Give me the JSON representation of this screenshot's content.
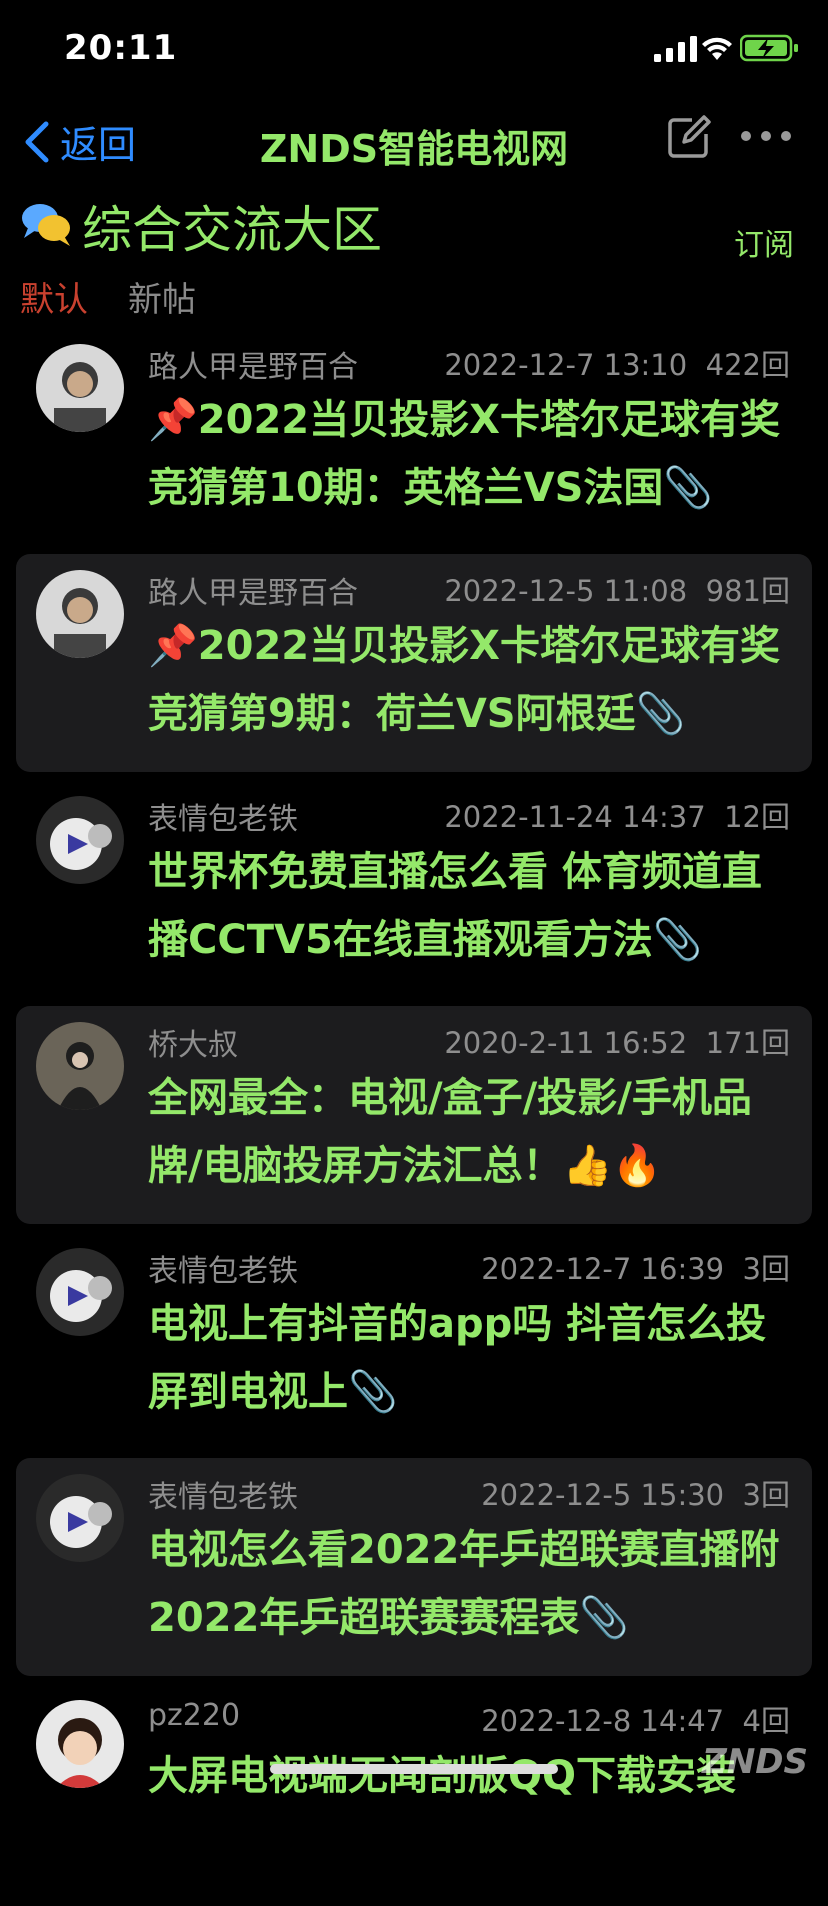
{
  "status_bar": {
    "time": "20:11"
  },
  "nav": {
    "back_label": "返回",
    "title": "ZNDS智能电视网"
  },
  "forum": {
    "name": "综合交流大区",
    "subscribe_label": "订阅",
    "tabs": [
      {
        "label": "默认",
        "active": true
      },
      {
        "label": "新帖",
        "active": false
      }
    ]
  },
  "threads": [
    {
      "author": "路人甲是野百合",
      "date": "2022-12-7 13:10",
      "replies": "422回",
      "title": "📌2022当贝投影X卡塔尔足球有奖竞猜第10期：英格兰VS法国📎"
    },
    {
      "author": "路人甲是野百合",
      "date": "2022-12-5 11:08",
      "replies": "981回",
      "title": "📌2022当贝投影X卡塔尔足球有奖竞猜第9期：荷兰VS阿根廷📎"
    },
    {
      "author": "表情包老铁",
      "date": "2022-11-24 14:37",
      "replies": "12回",
      "title": "世界杯免费直播怎么看 体育频道直播CCTV5在线直播观看方法📎"
    },
    {
      "author": "桥大叔",
      "date": "2020-2-11 16:52",
      "replies": "171回",
      "title": "全网最全：电视/盒子/投影/手机品牌/电脑投屏方法汇总！👍🔥"
    },
    {
      "author": "表情包老铁",
      "date": "2022-12-7 16:39",
      "replies": "3回",
      "title": "电视上有抖音的app吗 抖音怎么投屏到电视上📎"
    },
    {
      "author": "表情包老铁",
      "date": "2022-12-5 15:30",
      "replies": "3回",
      "title": "电视怎么看2022年乒超联赛直播附2022年乒超联赛赛程表📎"
    },
    {
      "author": "pz220",
      "date": "2022-12-8 14:47",
      "replies": "4回",
      "title": "大屏电视端无闻剖版QQ下载安装"
    }
  ],
  "watermark": "ZNDS",
  "colors": {
    "accent_green": "#94e86a",
    "link_blue": "#2f8cff",
    "active_tab_red": "#c9412f"
  }
}
